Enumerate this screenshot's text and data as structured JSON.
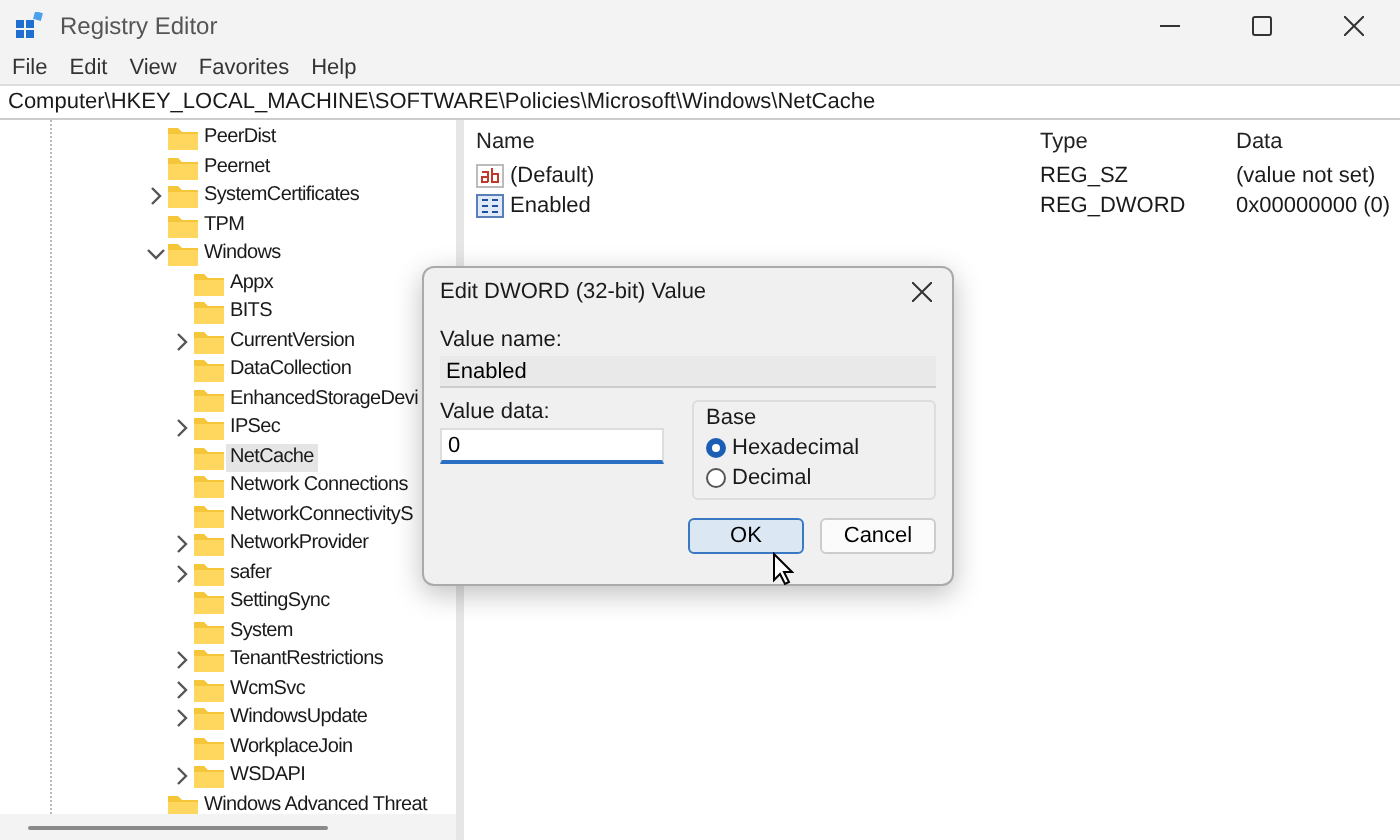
{
  "window": {
    "title": "Registry Editor"
  },
  "menu": [
    "File",
    "Edit",
    "View",
    "Favorites",
    "Help"
  ],
  "address": "Computer\\HKEY_LOCAL_MACHINE\\SOFTWARE\\Policies\\Microsoft\\Windows\\NetCache",
  "tree": [
    {
      "label": "PeerDist",
      "kind": "leaf",
      "selected": false
    },
    {
      "label": "Peernet",
      "kind": "leaf",
      "selected": false
    },
    {
      "label": "SystemCertificates",
      "kind": "collapsed",
      "selected": false
    },
    {
      "label": "TPM",
      "kind": "leaf",
      "selected": false
    },
    {
      "label": "Windows",
      "kind": "expanded",
      "selected": false,
      "children": [
        {
          "label": "Appx",
          "kind": "leaf",
          "selected": false
        },
        {
          "label": "BITS",
          "kind": "leaf",
          "selected": false
        },
        {
          "label": "CurrentVersion",
          "kind": "collapsed",
          "selected": false
        },
        {
          "label": "DataCollection",
          "kind": "leaf",
          "selected": false
        },
        {
          "label": "EnhancedStorageDevi",
          "kind": "leaf",
          "selected": false
        },
        {
          "label": "IPSec",
          "kind": "collapsed",
          "selected": false
        },
        {
          "label": "NetCache",
          "kind": "leaf",
          "selected": true
        },
        {
          "label": "Network Connections",
          "kind": "leaf",
          "selected": false
        },
        {
          "label": "NetworkConnectivityS",
          "kind": "leaf",
          "selected": false
        },
        {
          "label": "NetworkProvider",
          "kind": "collapsed",
          "selected": false
        },
        {
          "label": "safer",
          "kind": "collapsed",
          "selected": false
        },
        {
          "label": "SettingSync",
          "kind": "leaf",
          "selected": false
        },
        {
          "label": "System",
          "kind": "leaf",
          "selected": false
        },
        {
          "label": "TenantRestrictions",
          "kind": "collapsed",
          "selected": false
        },
        {
          "label": "WcmSvc",
          "kind": "collapsed",
          "selected": false
        },
        {
          "label": "WindowsUpdate",
          "kind": "collapsed",
          "selected": false
        },
        {
          "label": "WorkplaceJoin",
          "kind": "leaf",
          "selected": false
        },
        {
          "label": "WSDAPI",
          "kind": "collapsed",
          "selected": false
        }
      ]
    },
    {
      "label": "Windows Advanced Threat",
      "kind": "leaf",
      "selected": false
    }
  ],
  "values": {
    "columns": [
      "Name",
      "Type",
      "Data"
    ],
    "rows": [
      {
        "kind": "string",
        "name": "(Default)",
        "type": "REG_SZ",
        "data": "(value not set)"
      },
      {
        "kind": "binary",
        "name": "Enabled",
        "type": "REG_DWORD",
        "data": "0x00000000 (0)"
      }
    ]
  },
  "dialog": {
    "title": "Edit DWORD (32-bit) Value",
    "name_label": "Value name:",
    "name_value": "Enabled",
    "data_label": "Value data:",
    "data_value": "0",
    "base_label": "Base",
    "base_options": [
      {
        "label": "Hexadecimal",
        "selected": true
      },
      {
        "label": "Decimal",
        "selected": false
      }
    ],
    "buttons": [
      {
        "label": "OK",
        "default": true
      },
      {
        "label": "Cancel",
        "default": false
      }
    ]
  }
}
